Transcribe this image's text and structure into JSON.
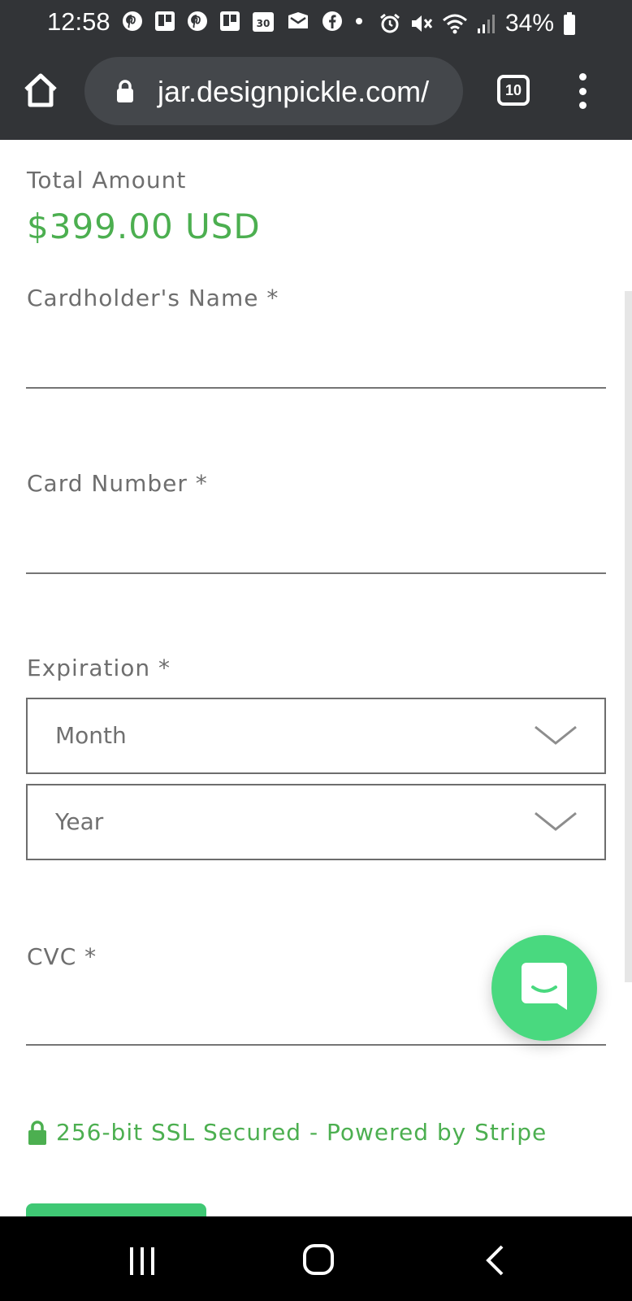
{
  "status_bar": {
    "time": "12:58",
    "battery": "34%",
    "notification_icons": [
      "pinterest-icon",
      "trello-icon",
      "pinterest-icon",
      "trello-icon",
      "calendar-icon",
      "gmail-icon",
      "facebook-icon",
      "dot-icon"
    ],
    "calendar_day": "30",
    "system_icons": [
      "alarm-icon",
      "mute-icon",
      "wifi-icon",
      "signal-icon",
      "battery-icon"
    ]
  },
  "browser": {
    "url": "jar.designpickle.com/",
    "tab_count": "10"
  },
  "form": {
    "total_label": "Total Amount",
    "total_value": "$399.00 USD",
    "name_label": "Cardholder's Name *",
    "card_label": "Card Number *",
    "expiration_label": "Expiration *",
    "month_placeholder": "Month",
    "year_placeholder": "Year",
    "cvc_label": "CVC *",
    "ssl_text": "256-bit SSL Secured - Powered by Stripe"
  },
  "colors": {
    "accent_green": "#4caf50",
    "chat_button": "#49d97f",
    "chrome_bg": "#323437"
  }
}
